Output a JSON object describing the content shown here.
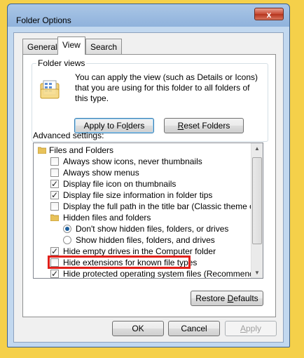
{
  "window": {
    "title": "Folder Options",
    "close_label": "x"
  },
  "tabs": [
    {
      "label": "General"
    },
    {
      "label": "View"
    },
    {
      "label": "Search"
    }
  ],
  "folder_views": {
    "legend": "Folder views",
    "description": "You can apply the view (such as Details or Icons) that you are using for this folder to all folders of this type.",
    "apply_button": {
      "pre": "Apply to Fo",
      "u": "l",
      "post": "ders"
    },
    "reset_button": {
      "pre": "",
      "u": "R",
      "post": "eset Folders"
    }
  },
  "advanced": {
    "label": "Advanced settings:",
    "items": [
      {
        "type": "folder",
        "label": "Files and Folders",
        "indent": 0
      },
      {
        "type": "checkbox",
        "label": "Always show icons, never thumbnails",
        "checked": false,
        "indent": 1
      },
      {
        "type": "checkbox",
        "label": "Always show menus",
        "checked": false,
        "indent": 1
      },
      {
        "type": "checkbox",
        "label": "Display file icon on thumbnails",
        "checked": true,
        "indent": 1
      },
      {
        "type": "checkbox",
        "label": "Display file size information in folder tips",
        "checked": true,
        "indent": 1
      },
      {
        "type": "checkbox",
        "label": "Display the full path in the title bar (Classic theme only)",
        "checked": false,
        "indent": 1
      },
      {
        "type": "folder",
        "label": "Hidden files and folders",
        "indent": 1
      },
      {
        "type": "radio",
        "label": "Don't show hidden files, folders, or drives",
        "checked": true,
        "indent": 2
      },
      {
        "type": "radio",
        "label": "Show hidden files, folders, and drives",
        "checked": false,
        "indent": 2
      },
      {
        "type": "checkbox",
        "label": "Hide empty drives in the Computer folder",
        "checked": true,
        "indent": 1
      },
      {
        "type": "checkbox",
        "label": "Hide extensions for known file types",
        "checked": false,
        "indent": 1
      },
      {
        "type": "checkbox",
        "label": "Hide protected operating system files (Recommended)",
        "checked": true,
        "indent": 1
      }
    ],
    "restore_button": {
      "pre": "Restore ",
      "u": "D",
      "post": "efaults"
    }
  },
  "footer": {
    "ok": "OK",
    "cancel": "Cancel",
    "apply": {
      "pre": "",
      "u": "A",
      "post": "pply"
    }
  },
  "colors": {
    "highlight_box": "#e0201a",
    "background": "#f5d04a"
  }
}
